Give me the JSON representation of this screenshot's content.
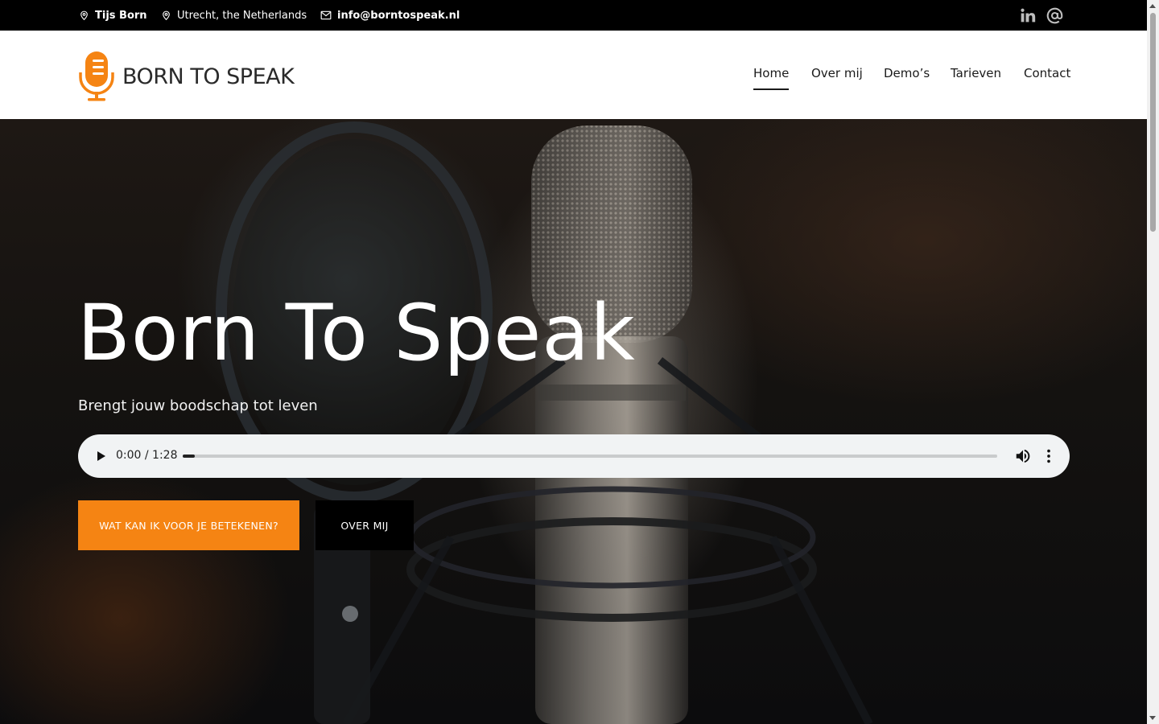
{
  "topbar": {
    "name": "Tijs Born",
    "location": "Utrecht, the Netherlands",
    "email": "info@borntospeak.nl",
    "social": [
      "linkedin-icon",
      "at-sign-icon"
    ]
  },
  "header": {
    "logo_text": "BORN TO SPEAK",
    "nav": [
      "Home",
      "Over mij",
      "Demo’s",
      "Tarieven",
      "Contact"
    ],
    "active_nav": "Home"
  },
  "hero": {
    "title": "Born To Speak",
    "subtitle": "Brengt jouw boodschap tot leven",
    "player": {
      "time": "0:00 / 1:28",
      "progress": 0.015
    },
    "primary_button": "WAT KAN IK VOOR JE BETEKENEN?",
    "secondary_button": "OVER MIJ"
  },
  "colors": {
    "accent": "#f58413",
    "topbar": "#000000",
    "text_dark": "#1a1a1a"
  }
}
